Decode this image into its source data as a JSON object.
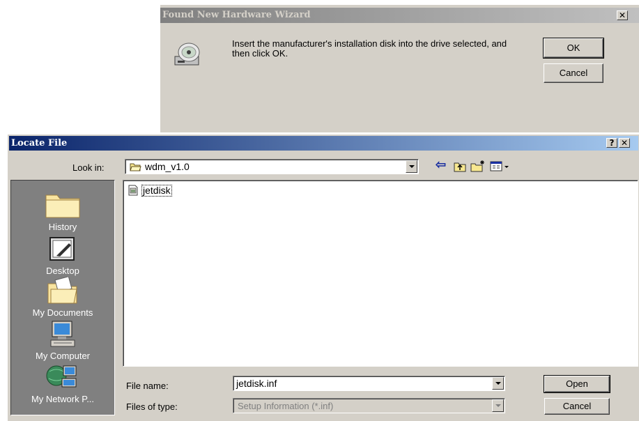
{
  "wizard": {
    "title": "Found New Hardware Wizard",
    "close_glyph": "✕",
    "message": "Insert the manufacturer's installation disk into the drive selected, and then click OK.",
    "ok_label": "OK",
    "cancel_label": "Cancel"
  },
  "locate": {
    "title": "Locate File",
    "help_glyph": "?",
    "close_glyph": "✕",
    "look_in_label": "Look in:",
    "look_in_value": "wdm_v1.0",
    "places": [
      {
        "label": "History",
        "icon": "history-folder-icon"
      },
      {
        "label": "Desktop",
        "icon": "desktop-icon"
      },
      {
        "label": "My Documents",
        "icon": "my-documents-icon"
      },
      {
        "label": "My Computer",
        "icon": "my-computer-icon"
      },
      {
        "label": "My Network P...",
        "icon": "my-network-places-icon"
      }
    ],
    "files": [
      {
        "name": "jetdisk",
        "icon": "setup-information-file-icon"
      }
    ],
    "file_name_label": "File name:",
    "file_name_value": "jetdisk.inf",
    "files_of_type_label": "Files of type:",
    "files_of_type_value": "Setup Information (*.inf)",
    "open_label": "Open",
    "cancel_label": "Cancel"
  },
  "colors": {
    "face": "#d4d0c8",
    "active_title": "#0a246a",
    "inactive_title": "#808080",
    "places_bar": "#808080"
  }
}
